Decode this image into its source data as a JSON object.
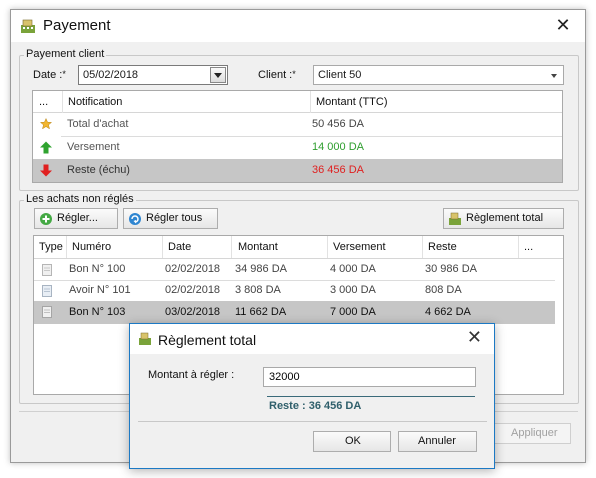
{
  "window": {
    "title": "Payement",
    "icon": "cash-register-icon"
  },
  "payment_client": {
    "legend": "Payement client",
    "date_label": "Date :",
    "date_value": "05/02/2018",
    "client_label": "Client :",
    "client_value": "Client 50",
    "required_mark": "*"
  },
  "notification_table": {
    "headers": [
      "...",
      "Notification",
      "Montant (TTC)"
    ],
    "rows": [
      {
        "icon": "star-icon",
        "label": "Total d'achat",
        "amount": "50 456 DA",
        "color": "#444444"
      },
      {
        "icon": "arrow-up-green-icon",
        "label": "Versement",
        "amount": "14 000 DA",
        "color": "#2e9e2e"
      },
      {
        "icon": "arrow-down-red-icon",
        "label": "Reste (échu)",
        "amount": "36 456 DA",
        "color": "#e02020"
      }
    ]
  },
  "unpaid": {
    "legend": "Les achats non réglés",
    "buttons": {
      "regler": "Régler...",
      "regler_tous": "Régler tous",
      "reglement_total": "Règlement total"
    },
    "headers": [
      "Type",
      "Numéro",
      "Date",
      "Montant",
      "Versement",
      "Reste",
      "..."
    ],
    "rows": [
      {
        "icon": "document-icon",
        "numero": "Bon N° 100",
        "date": "02/02/2018",
        "montant": "34 986 DA",
        "versement": "4 000 DA",
        "reste": "30 986 DA"
      },
      {
        "icon": "document-icon",
        "numero": "Avoir N° 101",
        "date": "02/02/2018",
        "montant": "3 808 DA",
        "versement": "3 000 DA",
        "reste": "808 DA"
      },
      {
        "icon": "document-icon",
        "numero": "Bon N° 103",
        "date": "03/02/2018",
        "montant": "11 662 DA",
        "versement": "7 000 DA",
        "reste": "4 662 DA"
      }
    ]
  },
  "footer": {
    "apply": "Appliquer"
  },
  "dialog": {
    "title": "Règlement total",
    "amount_label": "Montant à régler :",
    "amount_value": "32000",
    "rest_text": "Reste : 36 456 DA",
    "ok": "OK",
    "cancel": "Annuler"
  },
  "colors": {
    "selected_row": "#c6c6c6",
    "dialog_border": "#1c79c4",
    "rest_text": "#2f5f6b"
  }
}
